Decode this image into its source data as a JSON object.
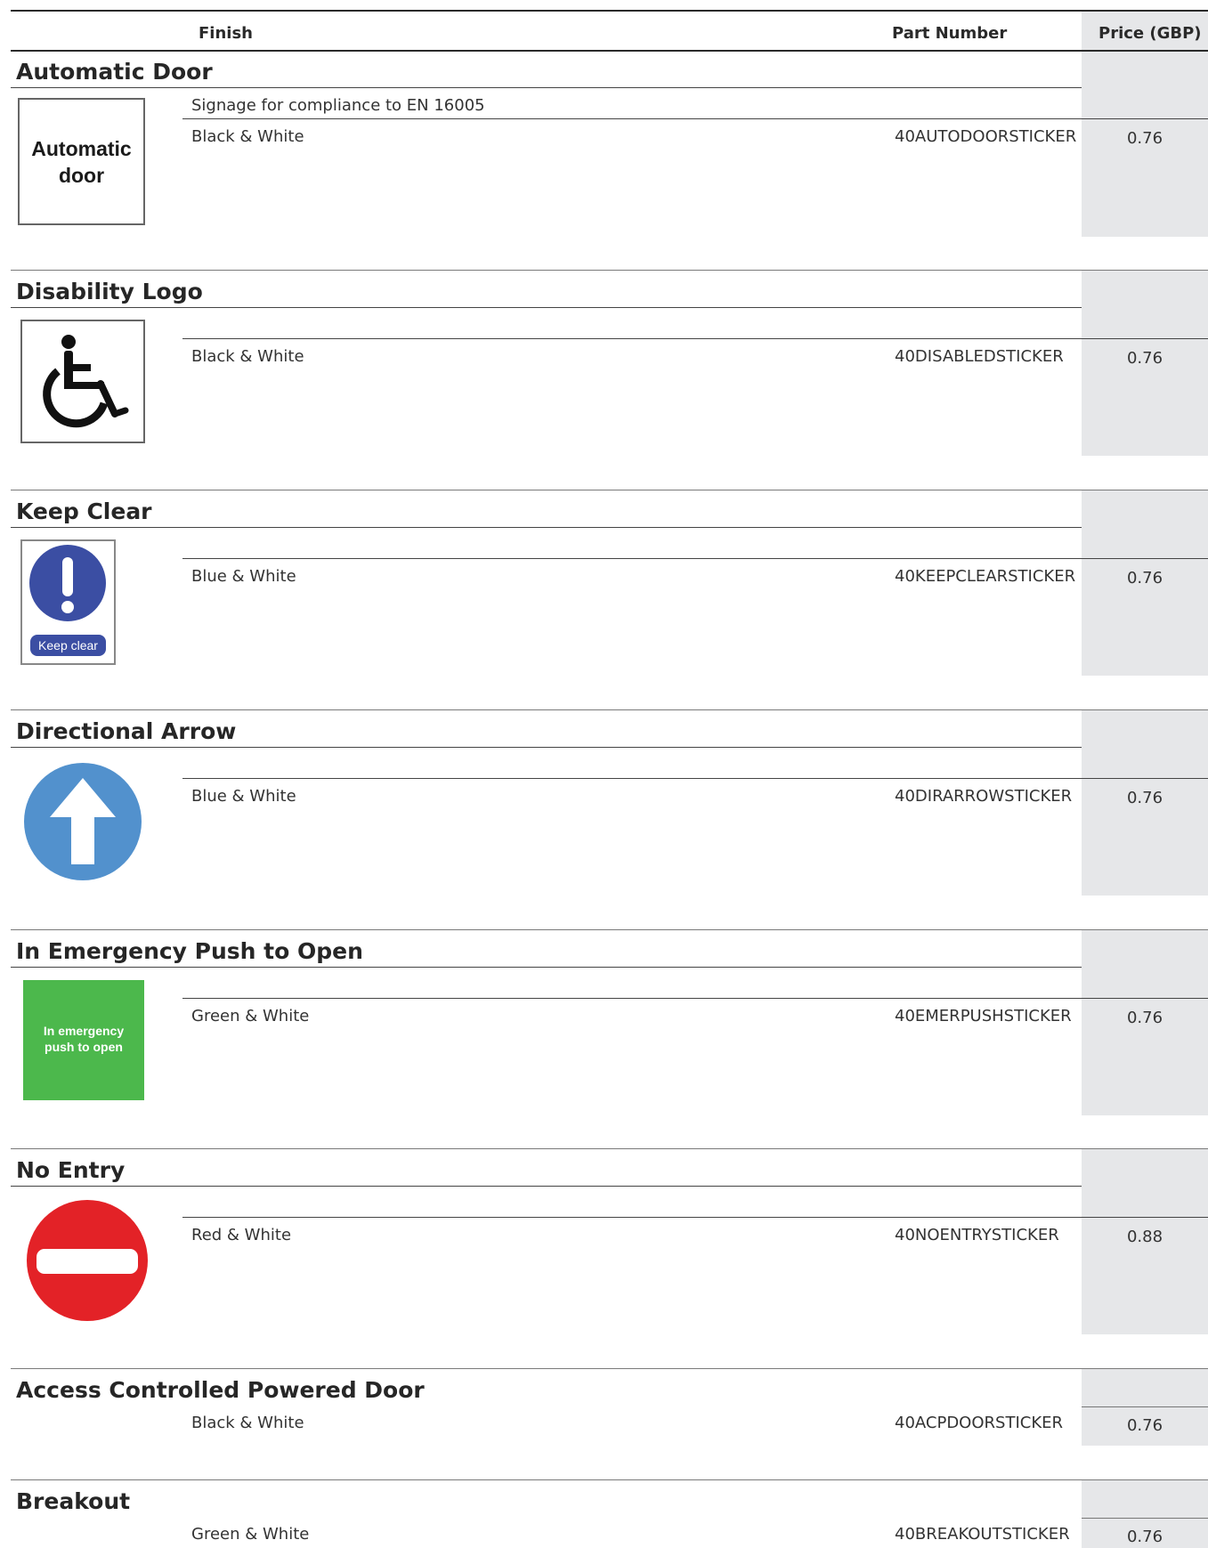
{
  "header": {
    "finish": "Finish",
    "part_number": "Part Number",
    "price": "Price (GBP)"
  },
  "sections": [
    {
      "title": "Automatic Door",
      "note": "Signage for compliance to EN 16005",
      "finish": "Black & White",
      "part_number": "40AUTODOORSTICKER",
      "price": "0.76",
      "sign": {
        "icon": "automatic-door-sign",
        "line1": "Automatic",
        "line2": "door"
      }
    },
    {
      "title": "Disability Logo",
      "finish": "Black & White",
      "part_number": "40DISABLEDSTICKER",
      "price": "0.76",
      "sign": {
        "icon": "wheelchair-sign"
      }
    },
    {
      "title": "Keep Clear",
      "finish": "Blue & White",
      "part_number": "40KEEPCLEARSTICKER",
      "price": "0.76",
      "sign": {
        "icon": "keep-clear-sign",
        "label": "Keep clear",
        "color": "#3b4ea3"
      }
    },
    {
      "title": "Directional Arrow",
      "finish": "Blue & White",
      "part_number": "40DIRARROWSTICKER",
      "price": "0.76",
      "sign": {
        "icon": "arrow-up-sign",
        "color": "#5291cd"
      }
    },
    {
      "title": "In Emergency Push to Open",
      "finish": "Green & White",
      "part_number": "40EMERPUSHSTICKER",
      "price": "0.76",
      "sign": {
        "icon": "emergency-push-sign",
        "line1": "In emergency",
        "line2": "push to open",
        "color": "#4cb84c"
      }
    },
    {
      "title": "No Entry",
      "finish": "Red & White",
      "part_number": "40NOENTRYSTICKER",
      "price": "0.88",
      "sign": {
        "icon": "no-entry-sign",
        "color": "#e32227"
      }
    },
    {
      "title": "Access Controlled Powered Door",
      "finish": "Black & White",
      "part_number": "40ACPDOORSTICKER",
      "price": "0.76"
    },
    {
      "title": "Breakout",
      "finish": "Green & White",
      "part_number": "40BREAKOUTSTICKER",
      "price": "0.76"
    }
  ]
}
